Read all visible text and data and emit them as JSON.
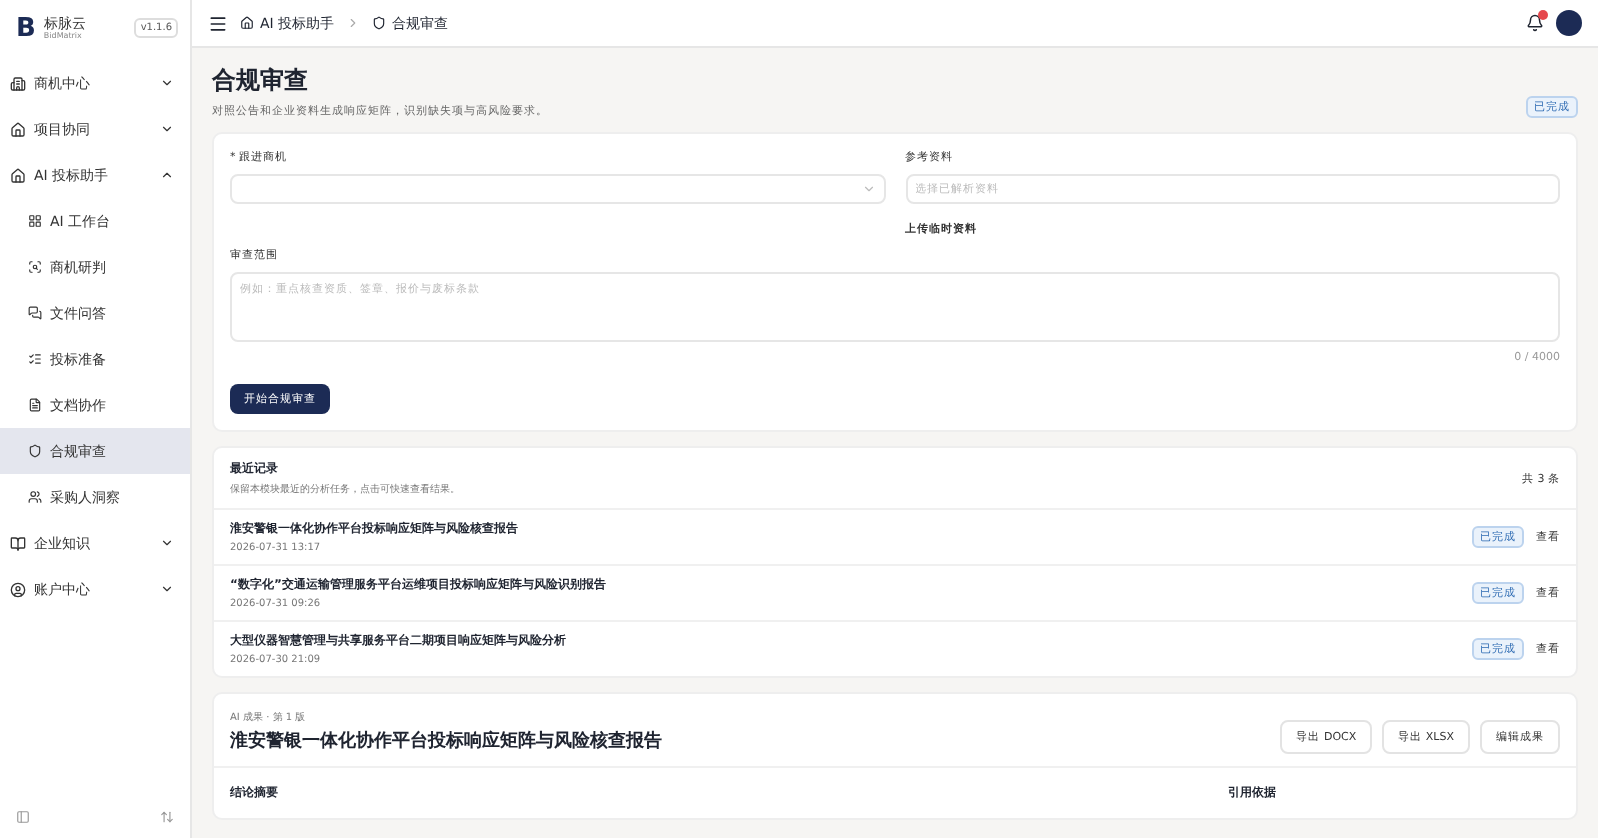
{
  "brand": {
    "logo": "B",
    "name": "标脉云",
    "subtitle": "BidMatrix",
    "version": "v1.1.6"
  },
  "sidebar": {
    "items": [
      {
        "label": "商机中心",
        "expanded": false,
        "selected": false
      },
      {
        "label": "项目协同",
        "expanded": false,
        "selected": false
      },
      {
        "label": "AI 投标助手",
        "expanded": true,
        "selected": false,
        "children": [
          {
            "label": "AI 工作台",
            "selected": false
          },
          {
            "label": "商机研判",
            "selected": false
          },
          {
            "label": "文件问答",
            "selected": false
          },
          {
            "label": "投标准备",
            "selected": false
          },
          {
            "label": "文档协作",
            "selected": false
          },
          {
            "label": "合规审查",
            "selected": true
          },
          {
            "label": "采购人洞察",
            "selected": false
          }
        ]
      },
      {
        "label": "企业知识",
        "expanded": false,
        "selected": false
      },
      {
        "label": "账户中心",
        "expanded": false,
        "selected": false
      }
    ]
  },
  "breadcrumb": [
    "AI 投标助手",
    "合规审查"
  ],
  "page": {
    "title": "合规审查",
    "subtitle": "对照公告和企业资料生成响应矩阵，识别缺失项与高风险要求。",
    "status": "已完成"
  },
  "form": {
    "required_mark": "*",
    "opportunity_label": "跟进商机",
    "reference_label": "参考资料",
    "reference_placeholder": "选择已解析资料",
    "upload_label": "上传临时资料",
    "scope_label": "审查范围",
    "scope_placeholder": "例如：重点核查资质、签章、报价与废标条款",
    "counter": "0 / 4000",
    "submit": "开始合规审查"
  },
  "records": {
    "title": "最近记录",
    "subtitle": "保留本模块最近的分析任务，点击可快速查看结果。",
    "count": "共 3 条",
    "rows": [
      {
        "title": "淮安警银一体化协作平台投标响应矩阵与风险核查报告",
        "time": "2026-07-31 13:17",
        "status": "已完成",
        "action": "查看"
      },
      {
        "title": "“数字化”交通运输管理服务平台运维项目投标响应矩阵与风险识别报告",
        "time": "2026-07-31 09:26",
        "status": "已完成",
        "action": "查看"
      },
      {
        "title": "大型仪器智慧管理与共享服务平台二期项目响应矩阵与风险分析",
        "time": "2026-07-30 21:09",
        "status": "已完成",
        "action": "查看"
      }
    ]
  },
  "result": {
    "meta": "AI 成果 · 第 1 版",
    "title": "淮安警银一体化协作平台投标响应矩阵与风险核查报告",
    "buttons": [
      "导出 DOCX",
      "导出 XLSX",
      "编辑成果"
    ],
    "section_left": "结论摘要",
    "section_right": "引用依据"
  }
}
